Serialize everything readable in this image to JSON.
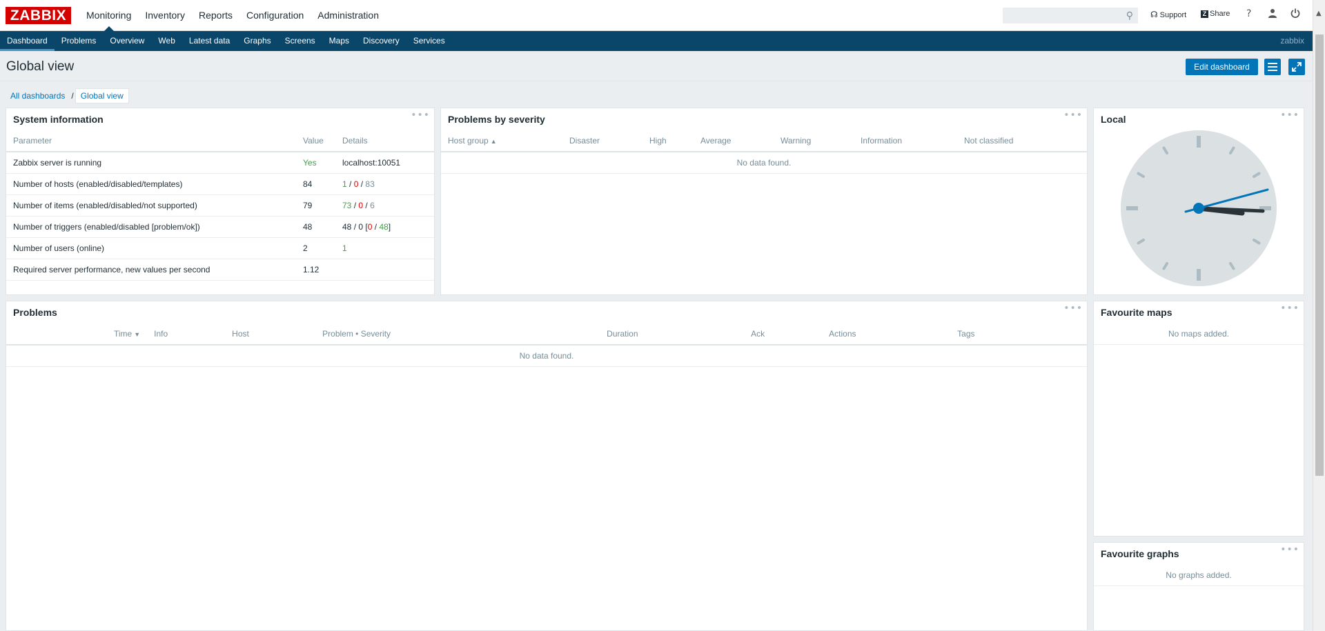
{
  "app": {
    "logo": "ZABBIX",
    "user": "zabbix"
  },
  "main_nav": [
    "Monitoring",
    "Inventory",
    "Reports",
    "Configuration",
    "Administration"
  ],
  "main_nav_active": "Monitoring",
  "toolbar": {
    "search_placeholder": "",
    "support": "Support",
    "share": "Share",
    "help": "?",
    "share_badge": "Z"
  },
  "sub_nav": [
    "Dashboard",
    "Problems",
    "Overview",
    "Web",
    "Latest data",
    "Graphs",
    "Screens",
    "Maps",
    "Discovery",
    "Services"
  ],
  "sub_nav_active": "Dashboard",
  "page": {
    "title": "Global view",
    "edit_button": "Edit dashboard"
  },
  "breadcrumb": {
    "root": "All dashboards",
    "separator": "/",
    "current": "Global view"
  },
  "widgets": {
    "menu_glyph": "•••",
    "system_information": {
      "title": "System information",
      "columns": [
        "Parameter",
        "Value",
        "Details"
      ],
      "rows": [
        {
          "parameter": "Zabbix server is running",
          "value": "Yes",
          "details": "localhost:10051"
        },
        {
          "parameter": "Number of hosts (enabled/disabled/templates)",
          "value": "84",
          "d1": "1",
          "d2": "0",
          "d3": "83"
        },
        {
          "parameter": "Number of items (enabled/disabled/not supported)",
          "value": "79",
          "d1": "73",
          "d2": "0",
          "d3": "6"
        },
        {
          "parameter": "Number of triggers (enabled/disabled [problem/ok])",
          "value": "48",
          "d1": "48",
          "d2": "0",
          "d3": "0",
          "d4": "48"
        },
        {
          "parameter": "Number of users (online)",
          "value": "2",
          "details": "1"
        },
        {
          "parameter": "Required server performance, new values per second",
          "value": "1.12",
          "details": ""
        }
      ]
    },
    "problems_by_severity": {
      "title": "Problems by severity",
      "columns": [
        "Host group",
        "Disaster",
        "High",
        "Average",
        "Warning",
        "Information",
        "Not classified"
      ],
      "no_data": "No data found."
    },
    "clock": {
      "title": "Local"
    },
    "problems": {
      "title": "Problems",
      "columns": [
        "Time",
        "Info",
        "Host",
        "Problem • Severity",
        "Duration",
        "Ack",
        "Actions",
        "Tags"
      ],
      "no_data": "No data found."
    },
    "favourite_maps": {
      "title": "Favourite maps",
      "empty": "No maps added."
    },
    "favourite_graphs": {
      "title": "Favourite graphs",
      "empty": "No graphs added."
    }
  },
  "colors": {
    "brand_red": "#d40000",
    "nav_blue": "#0a466a",
    "button_blue": "#0275b8",
    "ok_green": "#429e47",
    "problem_red": "#dc0000"
  }
}
